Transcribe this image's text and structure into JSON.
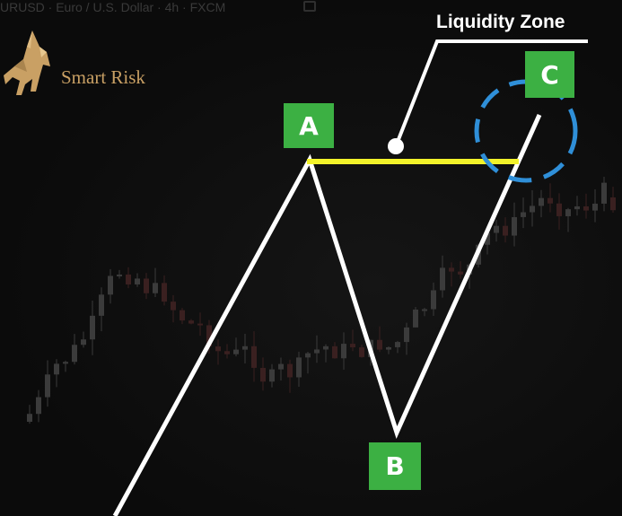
{
  "header": {
    "symbol_text": "URUSD · Euro / U.S. Dollar · 4h · FXCM"
  },
  "logo": {
    "text": "Smart Risk",
    "icon": "unicorn-icon"
  },
  "annotation": {
    "zone_label": "Liquidity Zone",
    "colors": {
      "zone_line": "#f2f22a",
      "circle": "#2f8fd8",
      "point_box": "#3cb043",
      "path": "#ffffff"
    }
  },
  "chart_data": {
    "type": "line",
    "points": [
      {
        "label": "A"
      },
      {
        "label": "B"
      },
      {
        "label": "C"
      }
    ],
    "annotations": [
      "Liquidity Zone"
    ]
  }
}
